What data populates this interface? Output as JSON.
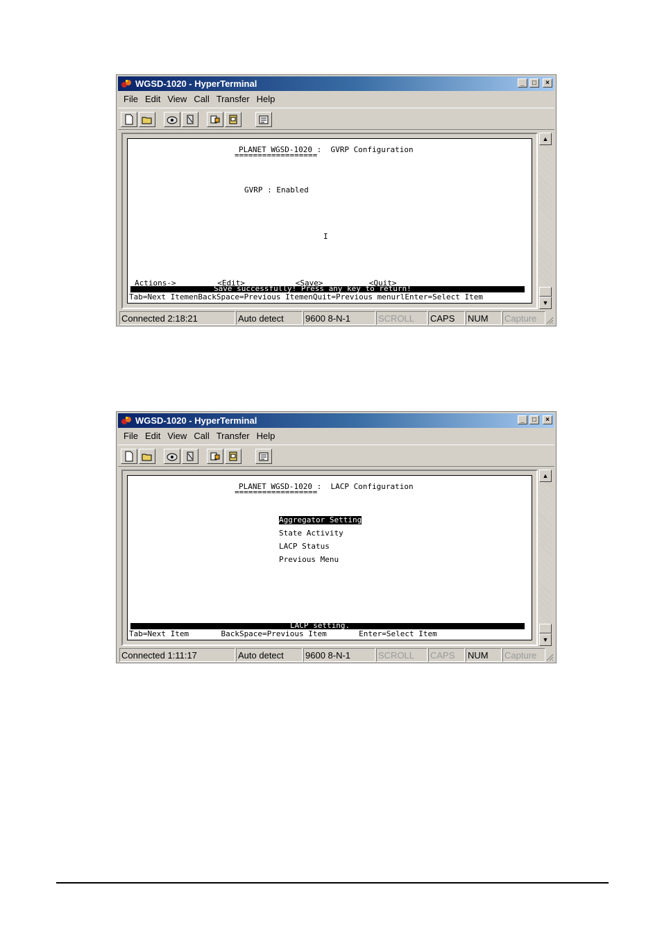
{
  "windows": [
    {
      "title": "WGSD-1020 - HyperTerminal",
      "menu": [
        "File",
        "Edit",
        "View",
        "Call",
        "Transfer",
        "Help"
      ],
      "terminal": {
        "header": "PLANET WGSD-1020 :  GVRP Configuration",
        "underline": "==================",
        "field": "GVRP : Enabled",
        "cursor": "I",
        "actions": "Actions->         <Edit>           <Save>          <Quit>",
        "message": "Save successfully! Press any key to return!",
        "help": "Tab=Next ItemenBackSpace=Previous ItemenQuit=Previous menurlEnter=Select Item"
      },
      "status": {
        "connected": "Connected 2:18:21",
        "detect": "Auto detect",
        "params": "9600 8-N-1",
        "scroll": "SCROLL",
        "caps": "CAPS",
        "num": "NUM",
        "capture": "Capture"
      }
    },
    {
      "title": "WGSD-1020 - HyperTerminal",
      "menu": [
        "File",
        "Edit",
        "View",
        "Call",
        "Transfer",
        "Help"
      ],
      "terminal": {
        "header": "PLANET WGSD-1020 :  LACP Configuration",
        "underline": "==================",
        "items": [
          "Aggregator Setting",
          "State Activity",
          "LACP Status",
          "Previous Menu"
        ],
        "message": "LACP setting.",
        "help": "Tab=Next Item       BackSpace=Previous Item       Enter=Select Item"
      },
      "status": {
        "connected": "Connected 1:11:17",
        "detect": "Auto detect",
        "params": "9600 8-N-1",
        "scroll": "SCROLL",
        "caps": "CAPS",
        "num": "NUM",
        "capture": "Capture"
      }
    }
  ],
  "colors": {
    "title_start": "#0a246a",
    "title_end": "#a6caf0",
    "chrome": "#d4d0c8"
  },
  "icons": [
    "hyperterminal-icon",
    "new-icon",
    "open-icon",
    "connect-icon",
    "disconnect-icon",
    "send-icon",
    "receive-icon",
    "properties-icon"
  ]
}
